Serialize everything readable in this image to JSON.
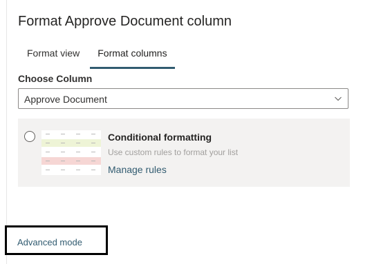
{
  "panel": {
    "title": "Format Approve Document column"
  },
  "tabs": [
    {
      "label": "Format view",
      "active": false
    },
    {
      "label": "Format columns",
      "active": true
    }
  ],
  "column_picker": {
    "label": "Choose Column",
    "selected": "Approve Document"
  },
  "conditional_formatting": {
    "title": "Conditional formatting",
    "description": "Use custom rules to format your list",
    "link": "Manage rules",
    "preview_row_colors": [
      "#ffffff",
      "#eef4d6",
      "#ffffff",
      "#f6d6d4",
      "#ffffff"
    ]
  },
  "footer": {
    "advanced_mode": "Advanced mode"
  },
  "colors": {
    "accent": "#315b70",
    "card_background": "#f3f2f1",
    "highlight_border": "#000000"
  }
}
